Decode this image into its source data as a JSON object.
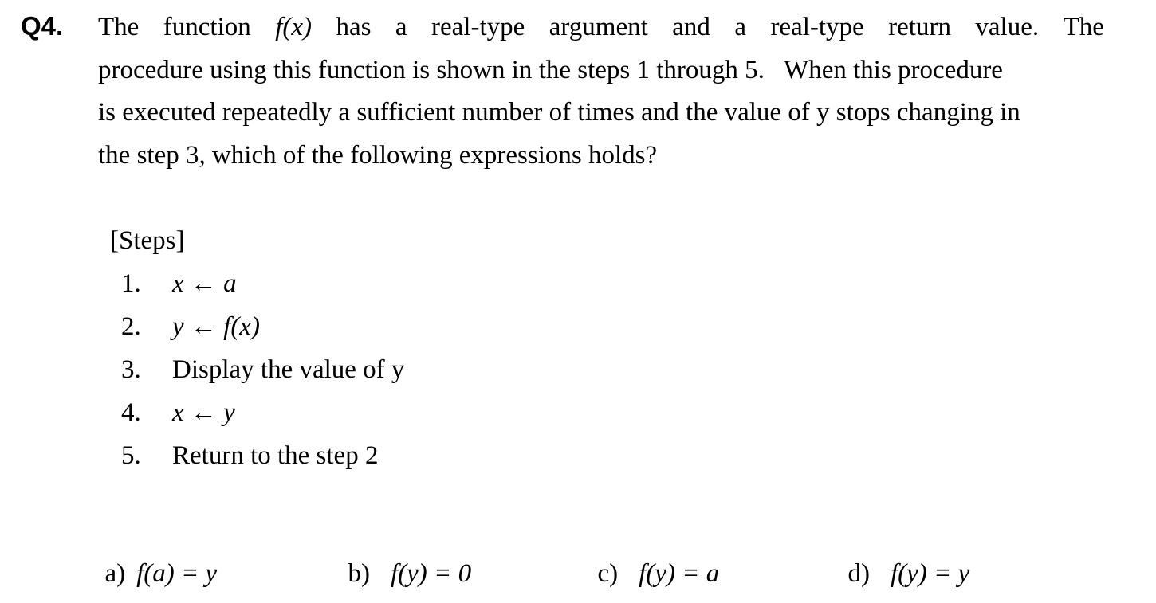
{
  "question": {
    "number": "Q4.",
    "lines": [
      [
        "The",
        "function",
        "f(x)",
        "has",
        "a",
        "real-type",
        "argument",
        "and",
        "a",
        "real-type",
        "return",
        "value.",
        "The"
      ],
      "procedure using this function is shown in the steps 1 through 5.   When this procedure",
      "is executed repeatedly a sufficient number of times and the value of y stops changing in",
      "the step 3, which of the following expressions holds?"
    ]
  },
  "steps": {
    "heading": "[Steps]",
    "items": [
      {
        "num": "1.",
        "text": "x ← a"
      },
      {
        "num": "2.",
        "text": "y ← f(x)"
      },
      {
        "num": "3.",
        "text": "Display the value of y"
      },
      {
        "num": "4.",
        "text": "x ← y"
      },
      {
        "num": "5.",
        "text": "Return to the step 2"
      }
    ]
  },
  "answers": [
    {
      "label": "a)",
      "expr": "f(a) = y"
    },
    {
      "label": "b)",
      "expr": "f(y) = 0"
    },
    {
      "label": "c)",
      "expr": "f(y) = a"
    },
    {
      "label": "d)",
      "expr": "f(y) = y"
    }
  ]
}
